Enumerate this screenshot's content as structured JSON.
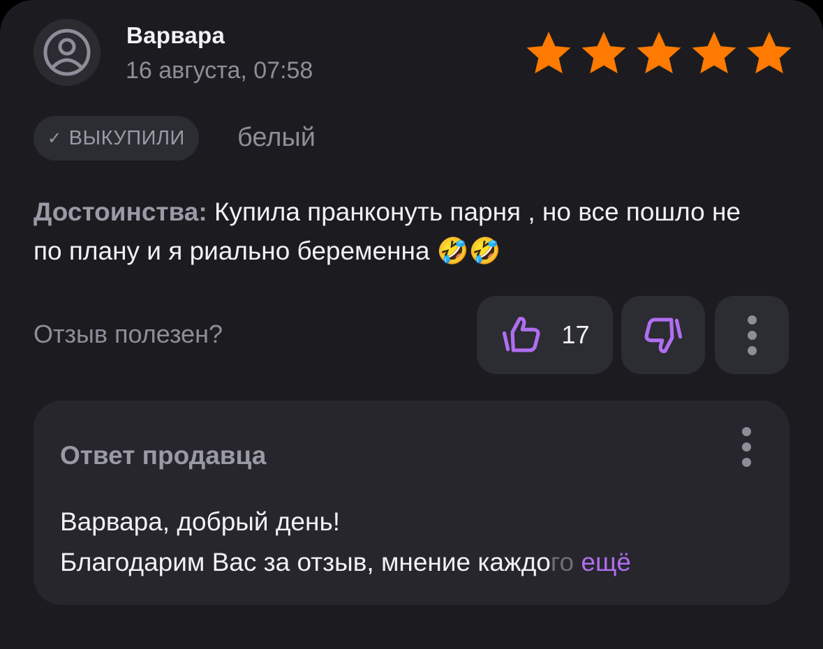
{
  "review": {
    "author": "Варвара",
    "date": "16 августа, 07:58",
    "rating": 5,
    "rating_max": 5,
    "badge": {
      "check": "✓",
      "label": "ВЫКУПИЛИ"
    },
    "variant": "белый",
    "pros_label": "Достоинства:",
    "pros_text": "Купила пранконуть парня , но все пошло не по плану и я риально беременна",
    "emojis": "🤣🤣"
  },
  "helpful": {
    "question": "Отзыв полезен?",
    "like_count": "17"
  },
  "seller_answer": {
    "title": "Ответ продавца",
    "line1": "Варвара, добрый день!",
    "line2": "Благодарим Вас за  отзыв, мнение каждо",
    "line2_fade": "го",
    "more_label": "ещё"
  },
  "colors": {
    "star": "#ff7a00",
    "accent": "#b06ef0",
    "card_bg": "#1c1c20"
  },
  "icons": [
    "user-avatar-icon",
    "star-icon",
    "check-icon",
    "thumbs-up-icon",
    "thumbs-down-icon",
    "more-vertical-icon"
  ]
}
